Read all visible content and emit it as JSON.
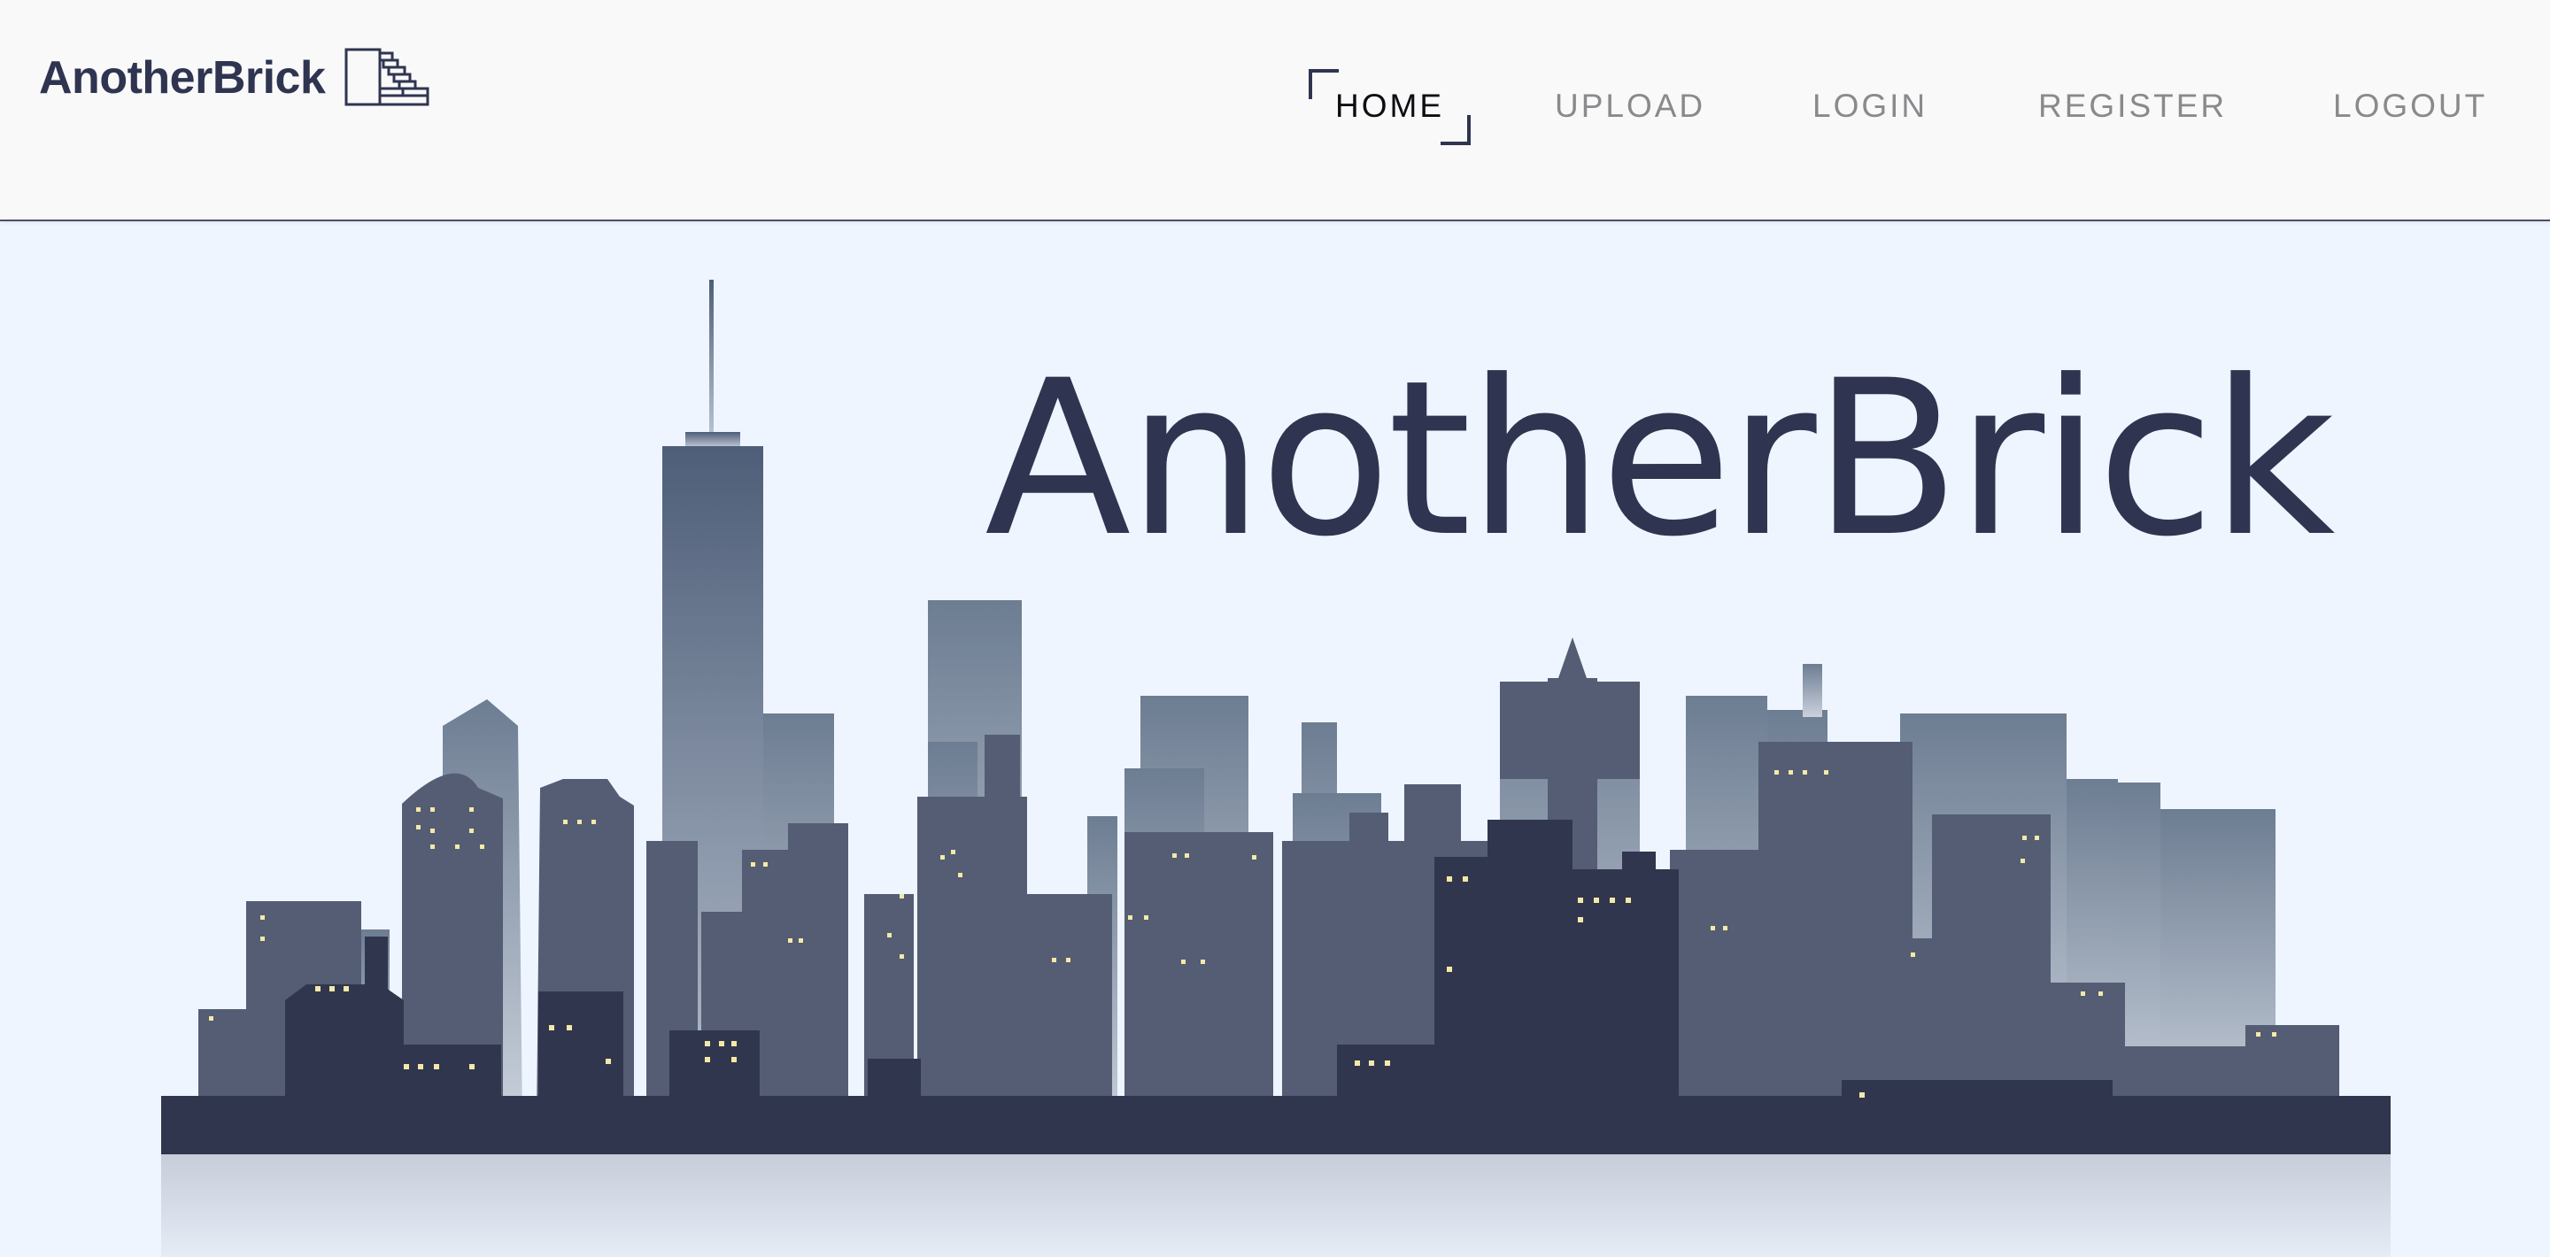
{
  "brand": {
    "name": "AnotherBrick",
    "logo_icon": "bricks-logo-icon"
  },
  "nav": {
    "items": [
      {
        "label": "HOME",
        "active": true
      },
      {
        "label": "UPLOAD",
        "active": false
      },
      {
        "label": "LOGIN",
        "active": false
      },
      {
        "label": "REGISTER",
        "active": false
      },
      {
        "label": "LOGOUT",
        "active": false
      }
    ]
  },
  "hero": {
    "title": "AnotherBrick",
    "illustration": "city-skyline-illustration"
  },
  "colors": {
    "navy": "#2f3550",
    "background": "#eef5ff",
    "nav_bg": "#f9f9fa",
    "window_light": "#f5e9a8"
  }
}
